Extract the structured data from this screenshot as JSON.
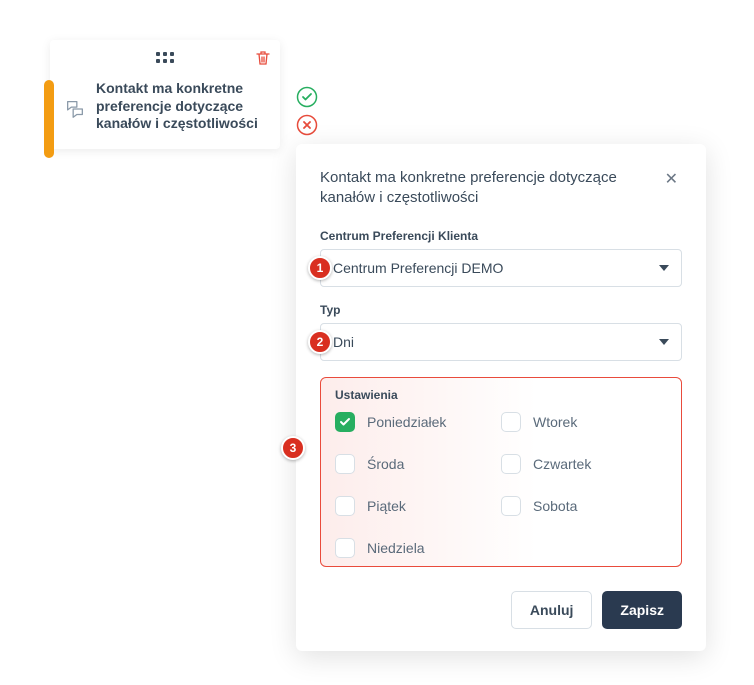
{
  "node": {
    "title": "Kontakt ma konkretne preferencje dotyczące kanałów i częstotliwości"
  },
  "panel": {
    "title": "Kontakt ma konkretne preferencje dotyczące kanałów i częstotliwości",
    "field1": {
      "label": "Centrum Preferencji Klienta",
      "value": "Centrum Preferencji DEMO"
    },
    "field2": {
      "label": "Typ",
      "value": "Dni"
    },
    "settings": {
      "label": "Ustawienia",
      "days": {
        "mon": "Poniedziałek",
        "tue": "Wtorek",
        "wed": "Środa",
        "thu": "Czwartek",
        "fri": "Piątek",
        "sat": "Sobota",
        "sun": "Niedziela"
      }
    },
    "buttons": {
      "cancel": "Anuluj",
      "save": "Zapisz"
    }
  },
  "badges": {
    "one": "1",
    "two": "2",
    "three": "3"
  }
}
